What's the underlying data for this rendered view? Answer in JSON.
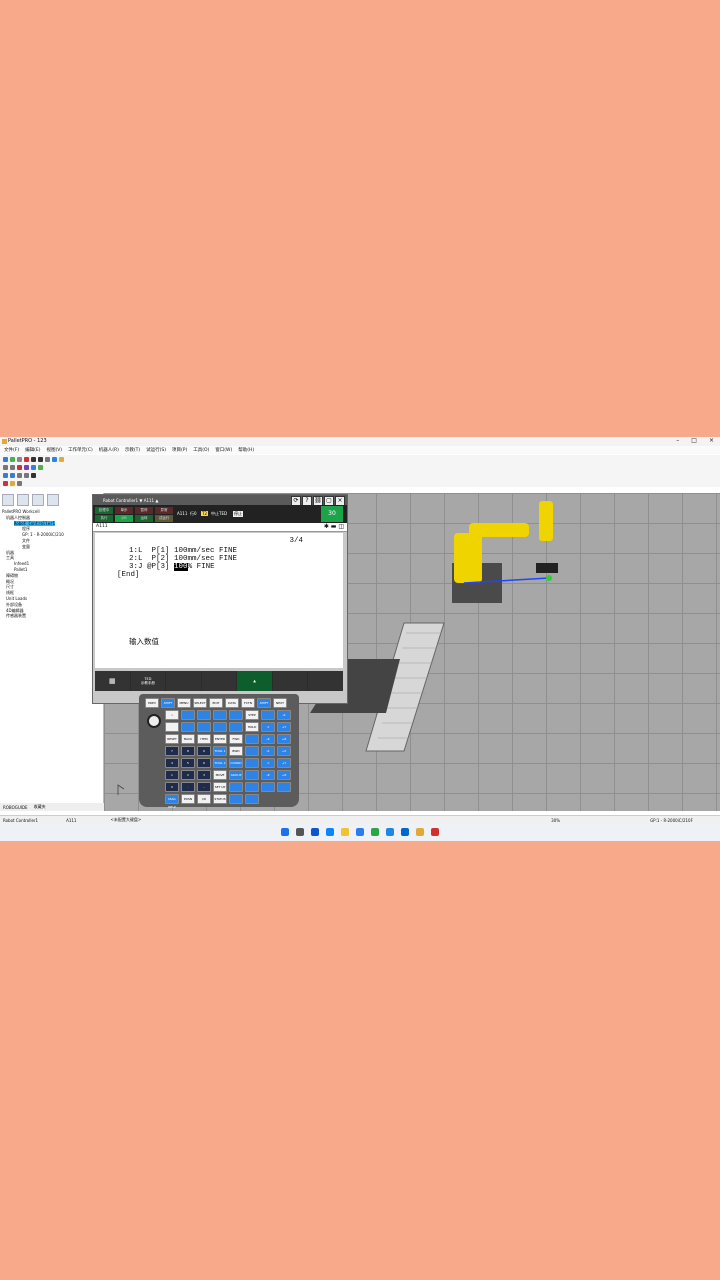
{
  "app": {
    "title": "PalletPRO - 123"
  },
  "menu": [
    "文件(F)",
    "编辑(E)",
    "视图(V)",
    "工作单元(C)",
    "机器人(R)",
    "示教(T)",
    "试运行(S)",
    "项目(P)",
    "工具(O)",
    "窗口(W)",
    "帮助(H)"
  ],
  "tree": {
    "root": "PalletPRO Workcell",
    "items": [
      "机器人控制器",
      "Robot Controller1",
      "程序",
      "GP: 1 - R-2000iC/210",
      "文件",
      "变量",
      "机器",
      "工具",
      "Infeed1",
      "Pallet1",
      "障碍物",
      "概况",
      "尺寸",
      "线框",
      "Unit Loads",
      "外部设备",
      "4D编辑器",
      "传感器装置"
    ],
    "tabs": [
      "ROBOGUIDE",
      "收藏夹"
    ]
  },
  "pendant": {
    "title": "Robot Controller1 ▼ A111 ▲",
    "program": "A111",
    "line_label": "行0",
    "status_t2": "T2",
    "status_text": "停止",
    "mode": "中止TED",
    "override": "30",
    "statuses": [
      "处理中",
      "单步",
      "暂停",
      "异常",
      "执行",
      "I/O",
      "运转",
      "试运行"
    ],
    "header": "A111",
    "page": "3/4",
    "lines": [
      {
        "num": "1:L",
        "text": "P[1] 100mm/sec FINE"
      },
      {
        "num": "2:L",
        "text": "P[2] 100mm/sec FINE"
      },
      {
        "num": "3:J",
        "text": "@P[3] ",
        "hl": "100",
        "rest": "% FINE"
      }
    ],
    "end": "[End]",
    "prompt": "输入数值",
    "fkey_label": "TED",
    "fkey_sub": "示教手册"
  },
  "keypad": [
    "PREV",
    "SHIFT",
    "MENU",
    "SELECT",
    "EDIT",
    "DATA",
    "FCTN",
    "SHIFT",
    "NEXT"
  ],
  "keypad_rows": [
    [
      "i",
      "",
      "",
      "",
      "",
      "STEP",
      "",
      "-X"
    ],
    [
      "",
      "",
      "",
      "",
      "",
      "HOLD",
      "-Y",
      "+Y"
    ],
    [
      "RESET",
      "BACK SPACE",
      "ITEM",
      "ENTER",
      "FWD",
      "",
      "-Z",
      "+Z"
    ],
    [
      "7",
      "8",
      "9",
      "TOOL 1",
      "BWD",
      "",
      "-X",
      "+X"
    ],
    [
      "4",
      "5",
      "6",
      "TOOL 2",
      "COORD",
      "",
      "-Y",
      "+Y"
    ],
    [
      "1",
      "2",
      "3",
      "MOVE MENU",
      "GROUP",
      "",
      "-Z",
      "+Z"
    ],
    [
      "0",
      ".",
      "-",
      "SET UP",
      "",
      "",
      "",
      ""
    ],
    [
      "DIAG HELP",
      "POSN",
      "I/O",
      "STATUS",
      "",
      "",
      "",
      ""
    ]
  ],
  "statusbar": {
    "left": "Robot Controller1",
    "prog": "A111",
    "hint": "<未配置大键盘>",
    "zoom": "30%",
    "gp": "GP:1 - R-2000iC/210F"
  }
}
